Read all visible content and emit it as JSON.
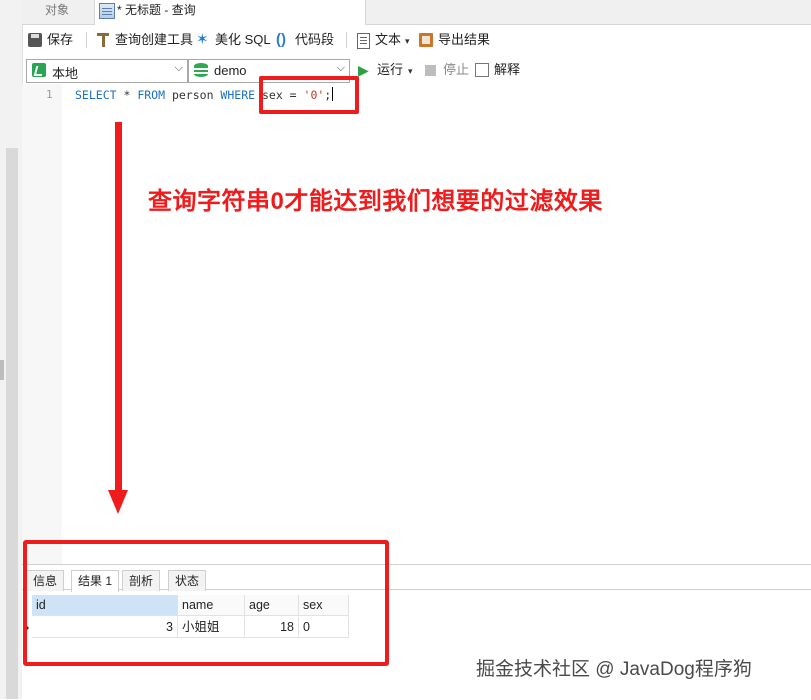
{
  "tabs": {
    "objects_label": "对象",
    "query_label": "* 无标题 - 查询"
  },
  "toolbar": {
    "save": "保存",
    "query_builder": "查询创建工具",
    "beautify_sql": "美化 SQL",
    "code_snippet": "代码段",
    "text": "文本",
    "export_results": "导出结果"
  },
  "toolbar2": {
    "connection": "本地",
    "database": "demo",
    "run": "运行",
    "stop": "停止",
    "explain": "解释"
  },
  "editor": {
    "line_number": "1",
    "sql": {
      "t1": "SELECT",
      "t2": " * ",
      "t3": "FROM",
      "t4": " person ",
      "t5": "WHERE",
      "t6": " sex = ",
      "t7": "'0'",
      "t8": ";"
    }
  },
  "annotation": {
    "text": "查询字符串0才能达到我们想要的过滤效果"
  },
  "result_tabs": [
    "信息",
    "结果 1",
    "剖析",
    "状态"
  ],
  "result_table": {
    "columns": [
      "id",
      "name",
      "age",
      "sex"
    ],
    "rows": [
      [
        "3",
        "小姐姐",
        "18",
        "0"
      ]
    ]
  },
  "watermark": "掘金技术社区 @ JavaDog程序狗",
  "colors": {
    "annotation_red": "#ee1c1c",
    "keyword_blue": "#1e6fc2",
    "string_red": "#c13a2a",
    "run_green": "#2ea043"
  },
  "icons": {
    "save": "save-icon",
    "query_builder": "hammer-icon",
    "beautify": "magic-wand-icon",
    "snippet": "parentheses-icon",
    "text": "document-icon",
    "export": "export-icon",
    "connection": "connection-icon",
    "database": "database-icon",
    "run": "play-icon",
    "stop": "stop-icon",
    "explain": "explain-icon"
  }
}
